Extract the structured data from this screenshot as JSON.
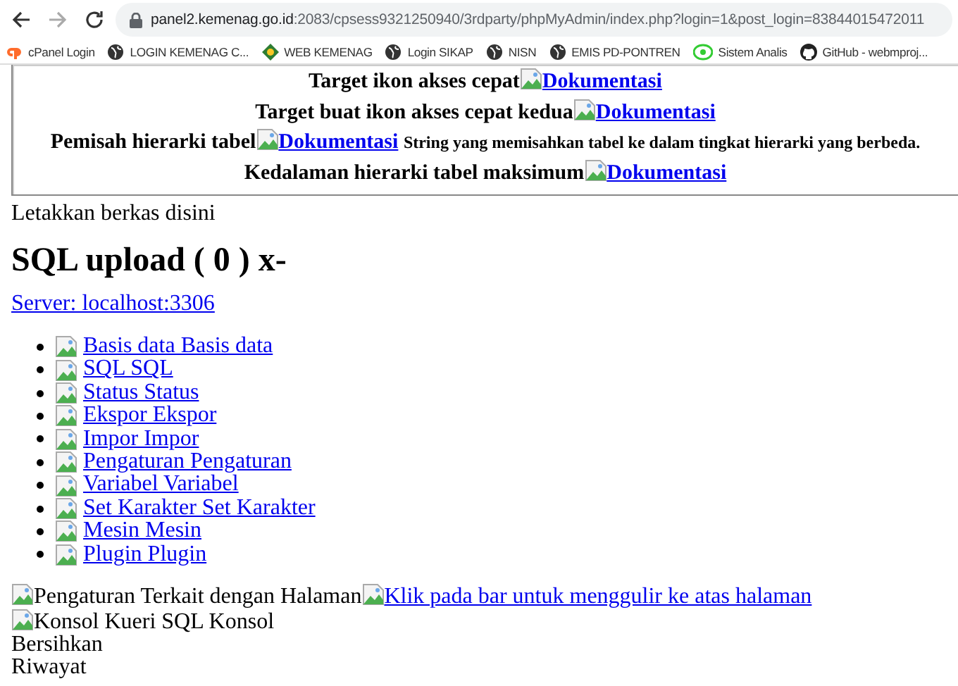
{
  "browser": {
    "url_host": "panel2.kemenag.go.id",
    "url_rest": ":2083/cpsess9321250940/3rdparty/phpMyAdmin/index.php?login=1&post_login=83844015472011",
    "bookmarks": [
      {
        "label": "cPanel Login",
        "kind": "cpanel"
      },
      {
        "label": "LOGIN KEMENAG C...",
        "kind": "globe"
      },
      {
        "label": "WEB KEMENAG",
        "kind": "emblem"
      },
      {
        "label": "Login SIKAP",
        "kind": "globe"
      },
      {
        "label": "NISN",
        "kind": "globe"
      },
      {
        "label": "EMIS PD-PONTREN",
        "kind": "globe"
      },
      {
        "label": "Sistem Analis",
        "kind": "sa"
      },
      {
        "label": "GitHub - webmproj...",
        "kind": "github"
      }
    ]
  },
  "settings_rows": [
    {
      "label": "Target ikon akses cepat",
      "link": "Dokumentasi"
    },
    {
      "label": "Target buat ikon akses cepat kedua",
      "link": "Dokumentasi"
    },
    {
      "label": "Pemisah hierarki tabel",
      "link": "Dokumentasi",
      "description": "String yang memisahkan tabel ke dalam tingkat hierarki yang berbeda."
    },
    {
      "label": "Kedalaman hierarki tabel maksimum",
      "link": "Dokumentasi"
    }
  ],
  "drop_text": "Letakkan berkas disini",
  "heading": "SQL upload ( 0 ) x-",
  "server_link": "Server: localhost:3306",
  "menu_items": [
    "Basis data Basis data",
    "SQL SQL",
    "Status Status",
    "Ekspor Ekspor",
    "Impor Impor",
    "Pengaturan Pengaturan",
    "Variabel Variabel",
    "Set Karakter Set Karakter",
    "Mesin Mesin",
    "Plugin Plugin"
  ],
  "page_settings_label": "Pengaturan Terkait dengan Halaman",
  "top_link": "Klik pada bar untuk menggulir ke atas halaman",
  "console_label": "Konsol Kueri SQL Konsol",
  "console_actions": [
    "Bersihkan",
    "Riwayat"
  ]
}
